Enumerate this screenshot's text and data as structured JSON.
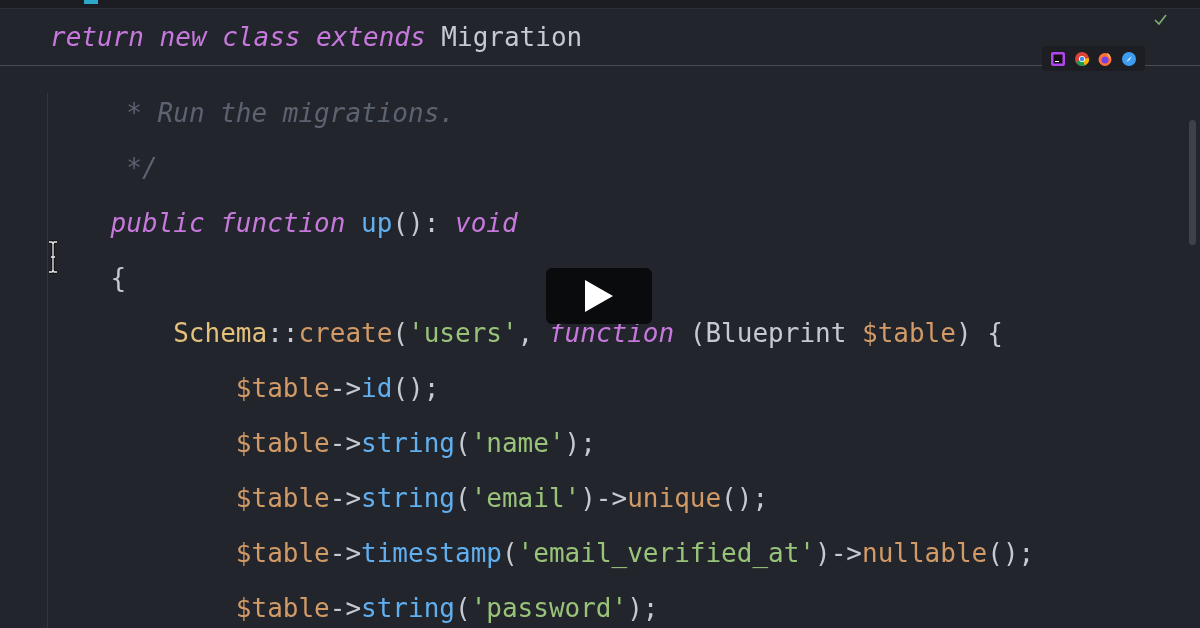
{
  "sticky_header": {
    "tokens": [
      {
        "text": "return new class extends",
        "kind": "keyword"
      },
      {
        "text": " Migration",
        "kind": "plain"
      }
    ]
  },
  "code": {
    "lines": [
      {
        "tokens": [
          {
            "text": " * Run the migrations.",
            "kind": "comment"
          }
        ]
      },
      {
        "tokens": [
          {
            "text": " */",
            "kind": "comment"
          }
        ]
      },
      {
        "tokens": [
          {
            "text": "public function",
            "kind": "keyword"
          },
          {
            "text": " up",
            "kind": "function"
          },
          {
            "text": "(): ",
            "kind": "plain"
          },
          {
            "text": "void",
            "kind": "keyword"
          }
        ]
      },
      {
        "tokens": [
          {
            "text": "{",
            "kind": "plain"
          }
        ],
        "children": [
          {
            "tokens": [
              {
                "text": "Schema",
                "kind": "class"
              },
              {
                "text": "::",
                "kind": "plain"
              },
              {
                "text": "create",
                "kind": "method"
              },
              {
                "text": "(",
                "kind": "plain"
              },
              {
                "text": "'users'",
                "kind": "string"
              },
              {
                "text": ", ",
                "kind": "plain"
              },
              {
                "text": "function",
                "kind": "keyword"
              },
              {
                "text": " (Blueprint ",
                "kind": "plain"
              },
              {
                "text": "$table",
                "kind": "variable"
              },
              {
                "text": ") {",
                "kind": "plain"
              }
            ],
            "children": [
              {
                "tokens": [
                  {
                    "text": "$table",
                    "kind": "variable"
                  },
                  {
                    "text": "->",
                    "kind": "plain"
                  },
                  {
                    "text": "id",
                    "kind": "function"
                  },
                  {
                    "text": "();",
                    "kind": "plain"
                  }
                ]
              },
              {
                "tokens": [
                  {
                    "text": "$table",
                    "kind": "variable"
                  },
                  {
                    "text": "->",
                    "kind": "plain"
                  },
                  {
                    "text": "string",
                    "kind": "function"
                  },
                  {
                    "text": "(",
                    "kind": "plain"
                  },
                  {
                    "text": "'name'",
                    "kind": "string"
                  },
                  {
                    "text": ");",
                    "kind": "plain"
                  }
                ]
              },
              {
                "tokens": [
                  {
                    "text": "$table",
                    "kind": "variable"
                  },
                  {
                    "text": "->",
                    "kind": "plain"
                  },
                  {
                    "text": "string",
                    "kind": "function"
                  },
                  {
                    "text": "(",
                    "kind": "plain"
                  },
                  {
                    "text": "'email'",
                    "kind": "string"
                  },
                  {
                    "text": ")->",
                    "kind": "plain"
                  },
                  {
                    "text": "unique",
                    "kind": "method"
                  },
                  {
                    "text": "();",
                    "kind": "plain"
                  }
                ]
              },
              {
                "tokens": [
                  {
                    "text": "$table",
                    "kind": "variable"
                  },
                  {
                    "text": "->",
                    "kind": "plain"
                  },
                  {
                    "text": "timestamp",
                    "kind": "function"
                  },
                  {
                    "text": "(",
                    "kind": "plain"
                  },
                  {
                    "text": "'email_verified_at'",
                    "kind": "string"
                  },
                  {
                    "text": ")->",
                    "kind": "plain"
                  },
                  {
                    "text": "nullable",
                    "kind": "method"
                  },
                  {
                    "text": "();",
                    "kind": "plain"
                  }
                ]
              },
              {
                "tokens": [
                  {
                    "text": "$table",
                    "kind": "variable"
                  },
                  {
                    "text": "->",
                    "kind": "plain"
                  },
                  {
                    "text": "string",
                    "kind": "function"
                  },
                  {
                    "text": "(",
                    "kind": "plain"
                  },
                  {
                    "text": "'password'",
                    "kind": "string"
                  },
                  {
                    "text": ");",
                    "kind": "plain"
                  }
                ]
              }
            ]
          }
        ]
      }
    ]
  }
}
